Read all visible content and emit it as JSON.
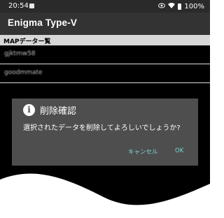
{
  "status_bar": {
    "time": "20:54",
    "icons": [
      "image-icon",
      "eye-icon",
      "wifi-icon",
      "battery-icon"
    ],
    "battery": "100%"
  },
  "app_bar": {
    "title": "Enigma Type-V"
  },
  "section": {
    "header": "MAPデーター覧"
  },
  "list": {
    "items": [
      {
        "label": "gjktmw58"
      },
      {
        "label": "goodmmate"
      }
    ]
  },
  "dialog": {
    "icon": "info-icon",
    "title": "削除確認",
    "message": "選択されたデータを削除してよろしいでしょうか?",
    "cancel_label": "キャンセル",
    "ok_label": "OK"
  },
  "colors": {
    "dialog_bg": "#4e4e4e",
    "accent": "#7fd6d0",
    "app_bar": "#333333",
    "section_header": "#d7d7d7"
  }
}
